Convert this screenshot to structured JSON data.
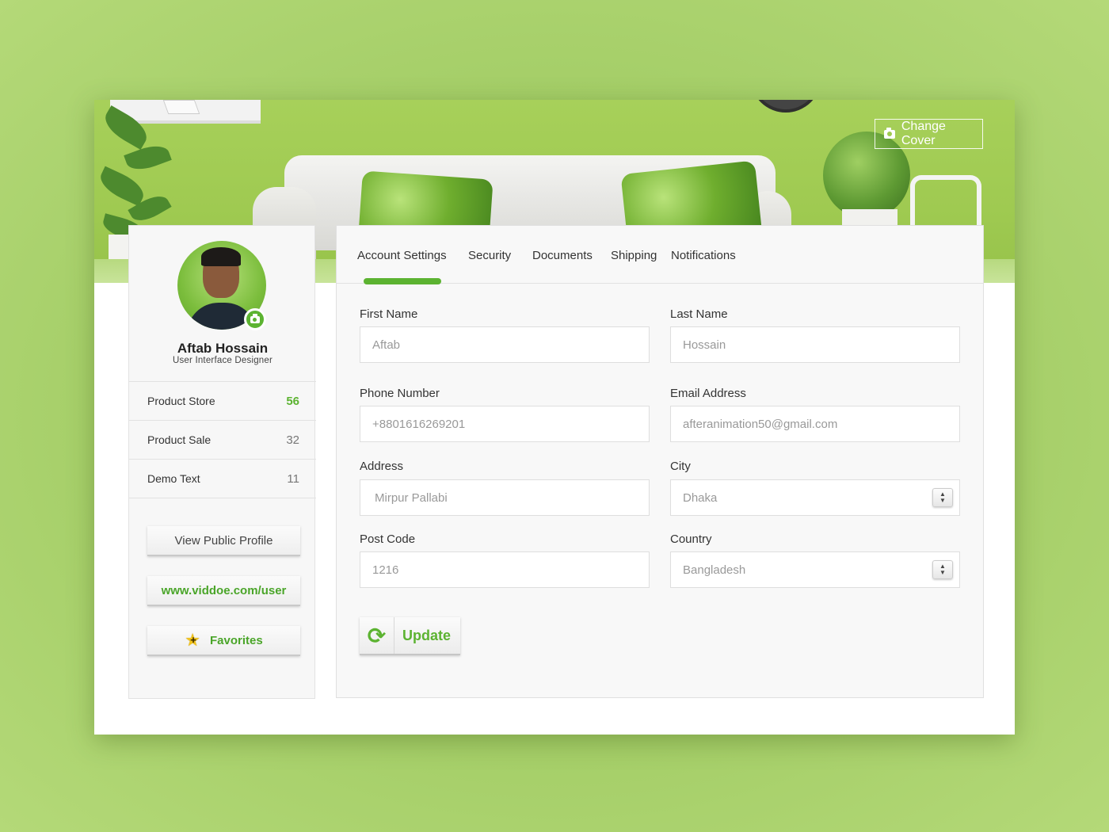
{
  "cover": {
    "change_label": "Change Cover"
  },
  "profile": {
    "name": "Aftab Hossain",
    "role": "User Interface Designer",
    "stats": [
      {
        "label": "Product Store",
        "value": "56"
      },
      {
        "label": "Product Sale",
        "value": "32"
      },
      {
        "label": "Demo Text",
        "value": "11"
      }
    ],
    "buttons": {
      "public_profile": "View Public Profile",
      "url": "www.viddoe.com/user",
      "favorites": "Favorites"
    }
  },
  "tabs": [
    "Account Settings",
    "Security",
    "Documents",
    "Shipping",
    "Notifications"
  ],
  "form": {
    "first_name": {
      "label": "First Name",
      "value": "Aftab"
    },
    "last_name": {
      "label": "Last Name",
      "value": "Hossain"
    },
    "phone": {
      "label": "Phone Number",
      "value": "+8801616269201"
    },
    "email": {
      "label": "Email Address",
      "value": "afteranimation50@gmail.com"
    },
    "address": {
      "label": "Address",
      "value": "Mirpur Pallabi"
    },
    "city": {
      "label": "City",
      "value": "Dhaka"
    },
    "post_code": {
      "label": "Post Code",
      "value": "1216"
    },
    "country": {
      "label": "Country",
      "value": "Bangladesh"
    },
    "update_label": "Update"
  },
  "colors": {
    "accent": "#5cb331",
    "background": "#a6cf6c"
  }
}
